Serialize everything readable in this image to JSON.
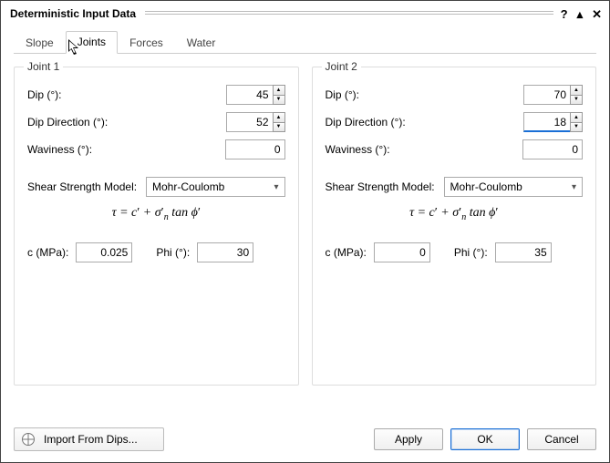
{
  "window": {
    "title": "Deterministic Input Data",
    "help": "?",
    "expand": "▴",
    "close": "✕"
  },
  "tabs": {
    "slope": "Slope",
    "joints": "Joints",
    "forces": "Forces",
    "water": "Water",
    "active": "joints"
  },
  "labels": {
    "dip": "Dip (°):",
    "dipdir": "Dip Direction (°):",
    "waviness": "Waviness (°):",
    "shear": "Shear Strength Model:",
    "c": "c (MPa):",
    "phi": "Phi (°):"
  },
  "joint1": {
    "title": "Joint 1",
    "dip": "45",
    "dipdir": "52",
    "waviness": "0",
    "model": "Mohr-Coulomb",
    "c": "0.025",
    "phi": "30"
  },
  "joint2": {
    "title": "Joint 2",
    "dip": "70",
    "dipdir": "18",
    "waviness": "0",
    "model": "Mohr-Coulomb",
    "c": "0",
    "phi": "35"
  },
  "footer": {
    "import": "Import From Dips...",
    "apply": "Apply",
    "ok": "OK",
    "cancel": "Cancel"
  }
}
